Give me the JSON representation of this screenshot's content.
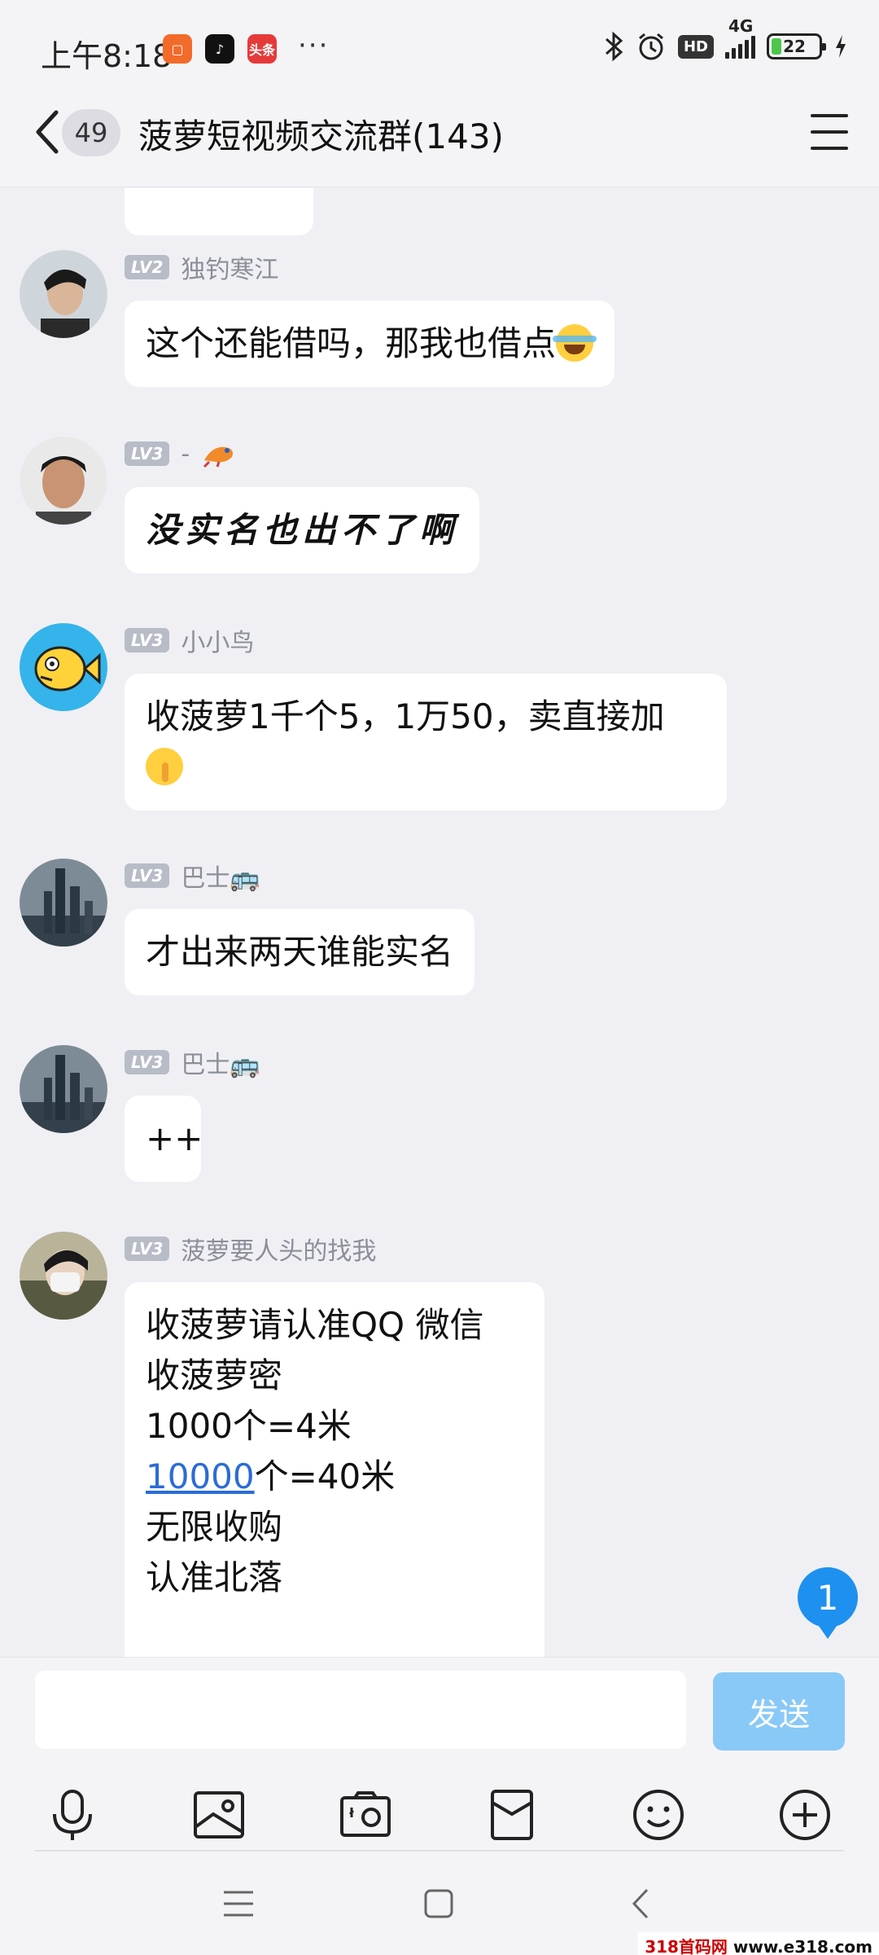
{
  "status_bar": {
    "time": "上午8:18",
    "app_badge_toutiao": "头条",
    "more_dots": "···",
    "network": "4G",
    "hd": "HD",
    "battery": "22",
    "battery_level": 0.22
  },
  "header": {
    "unread_count": "49",
    "title": "菠萝短视频交流群(143)"
  },
  "messages": [
    {
      "level": "LV2",
      "name": "独钓寒江",
      "text": "这个还能借吗，那我也借点",
      "emoji": "laugh-cry"
    },
    {
      "level": "LV3",
      "name": "-",
      "text": "没实名也出不了啊",
      "style": "handwritten"
    },
    {
      "level": "LV3",
      "name": "小小鸟",
      "text": "收菠萝1千个5，1万50，卖直接加",
      "emoji": "shush"
    },
    {
      "level": "LV3",
      "name": "巴士🚌",
      "text": "才出来两天谁能实名"
    },
    {
      "level": "LV3",
      "name": "巴士🚌",
      "text": "++"
    },
    {
      "level": "LV3",
      "name": "菠萝要人头的找我",
      "lines": [
        "收菠萝请认准QQ 微信",
        "",
        "收菠萝密",
        "1000个=4米"
      ],
      "link": "10000",
      "link_suffix": "个=40米",
      "tail_lines": [
        "无限收购",
        "认准北落"
      ]
    }
  ],
  "floating_unread": "1",
  "input": {
    "placeholder": "",
    "send_label": "发送"
  },
  "toolbar_icons": [
    "microphone-icon",
    "image-icon",
    "camera-icon",
    "red-envelope-icon",
    "emoji-icon",
    "plus-icon"
  ],
  "nav_icons": [
    "menu-icon",
    "home-icon",
    "back-icon"
  ],
  "watermark": {
    "prefix": "318首码网",
    "domain": "www.e318.com"
  },
  "colors": {
    "accent": "#1e90f0",
    "send_disabled": "#89c9f7",
    "link": "#2b6cd6",
    "level_badge": "#b7bcc7",
    "background": "#f0f0f4"
  }
}
